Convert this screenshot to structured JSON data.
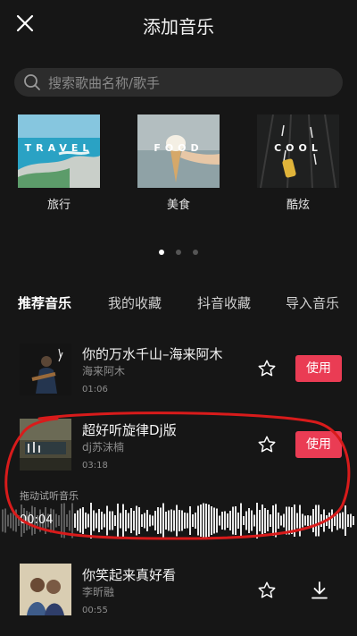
{
  "header": {
    "title": "添加音乐",
    "close_icon": "close-icon"
  },
  "search": {
    "placeholder": "搜索歌曲名称/歌手",
    "icon": "search-icon"
  },
  "categories": [
    {
      "label": "旅行",
      "thumb_text": "TRAVEL"
    },
    {
      "label": "美食",
      "thumb_text": "FOOD"
    },
    {
      "label": "酷炫",
      "thumb_text": "COOL"
    }
  ],
  "carousel": {
    "page_count": 3,
    "active_index": 0
  },
  "tabs": [
    {
      "label": "推荐音乐",
      "active": true
    },
    {
      "label": "我的收藏",
      "active": false
    },
    {
      "label": "抖音收藏",
      "active": false
    },
    {
      "label": "导入音乐",
      "active": false
    }
  ],
  "songs": [
    {
      "title": "你的万水千山–海来阿木",
      "artist": "海来阿木",
      "duration": "01:06",
      "action": "使用"
    },
    {
      "title": "超好听旋律Dj版",
      "artist": "dj苏沫楠",
      "duration": "03:18",
      "action": "使用",
      "preview_label": "拖动试听音乐",
      "preview_time": "00:04"
    },
    {
      "title": "你笑起来真好看",
      "artist": "李昕融",
      "duration": "00:55",
      "action_icon": "download-icon"
    }
  ],
  "colors": {
    "background": "#161616",
    "accent": "#ea3c54",
    "annotation": "#d81b1b"
  }
}
